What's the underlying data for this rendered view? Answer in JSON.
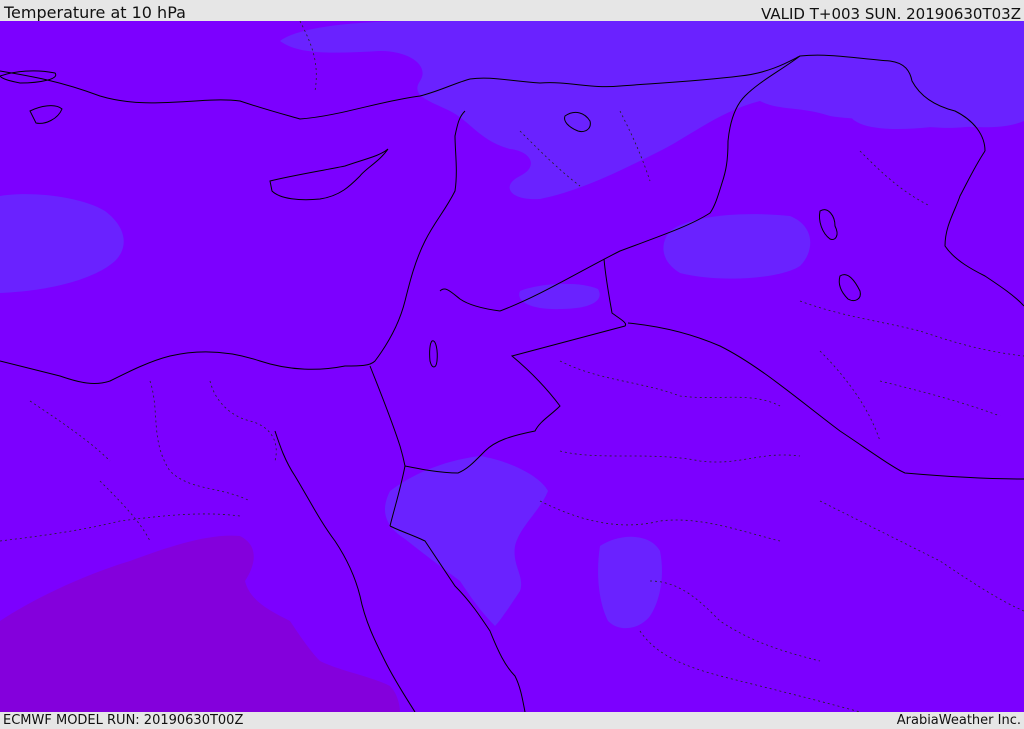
{
  "header": {
    "title": "Temperature at 10 hPa",
    "valid": "VALID T+003 SUN. 20190630T03Z"
  },
  "footer": {
    "model_run": "ECMWF MODEL RUN: 20190630T00Z",
    "credit": "ArabiaWeather Inc."
  },
  "map": {
    "region": "Eastern Mediterranean and Middle East",
    "field": "temperature",
    "colors": {
      "base": "#7c00ff",
      "cooler_patch": "#6a22ff",
      "warmer_patch": "#8400dc",
      "border": "#000000"
    }
  }
}
